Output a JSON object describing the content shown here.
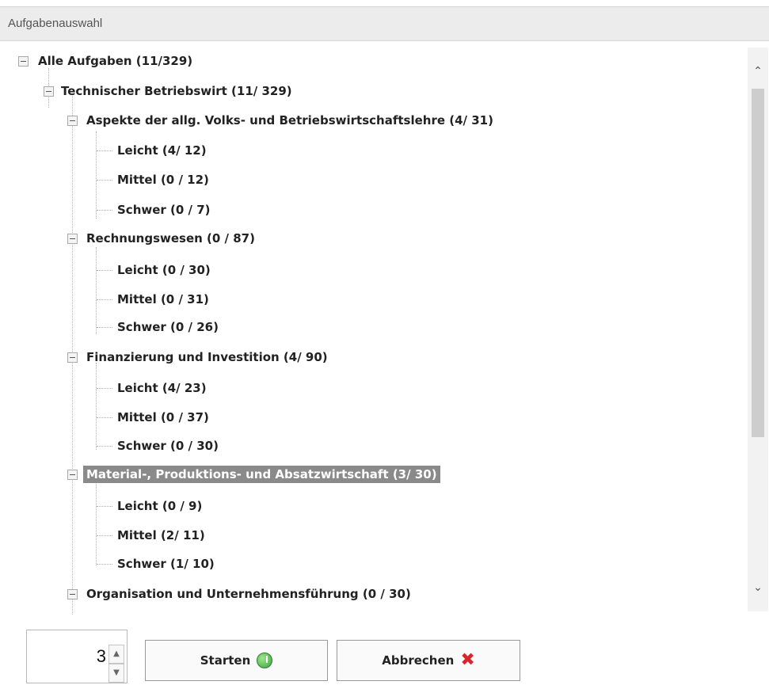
{
  "window": {
    "title": "Aufgabenauswahl"
  },
  "tree": {
    "root": "Alle Aufgaben (11/329)",
    "course": "Technischer Betriebswirt (11/ 329)",
    "categories": [
      {
        "label": "Aspekte der allg. Volks- und Betriebswirtschaftslehre (4/ 31)",
        "children": [
          "Leicht (4/ 12)",
          "Mittel (0 / 12)",
          "Schwer (0 / 7)"
        ]
      },
      {
        "label": "Rechnungswesen (0 / 87)",
        "children": [
          "Leicht (0 / 30)",
          "Mittel (0 / 31)",
          "Schwer (0 / 26)"
        ]
      },
      {
        "label": "Finanzierung und Investition (4/ 90)",
        "children": [
          "Leicht (4/ 23)",
          "Mittel (0 / 37)",
          "Schwer (0 / 30)"
        ]
      },
      {
        "label": "Material-, Produktions- und Absatzwirtschaft (3/ 30)",
        "selected": true,
        "children": [
          "Leicht (0 / 9)",
          "Mittel (2/ 11)",
          "Schwer (1/ 10)"
        ]
      },
      {
        "label": "Organisation und Unternehmensführung (0 / 30)",
        "children": []
      }
    ]
  },
  "footer": {
    "count_value": "3",
    "start_label": "Starten",
    "cancel_label": "Abbrechen"
  },
  "icons": {
    "scroll_up": "chevron-up-icon",
    "scroll_down": "chevron-down-icon",
    "start": "green-go-icon",
    "cancel": "red-x-icon"
  }
}
